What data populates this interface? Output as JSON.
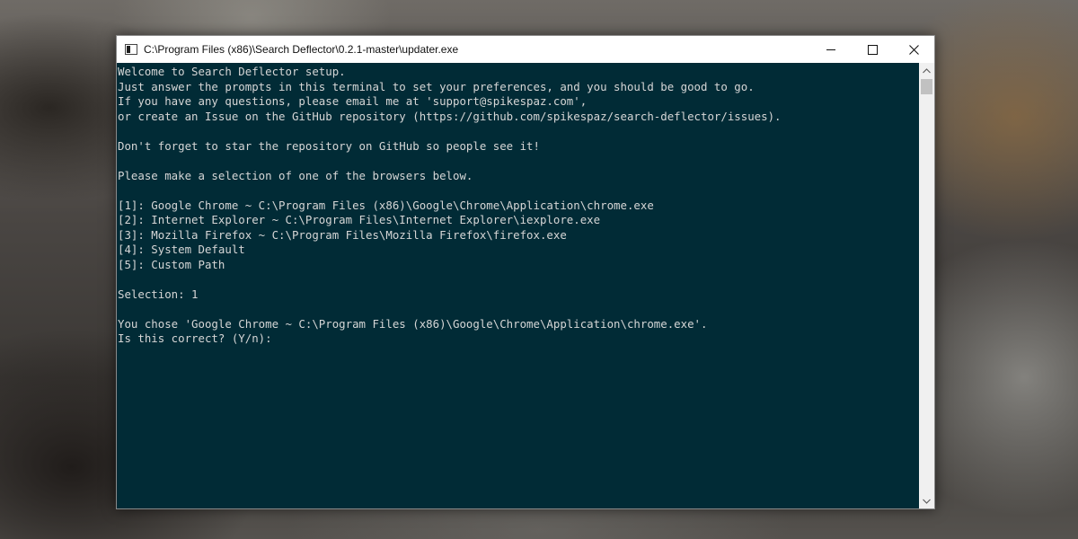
{
  "window": {
    "title": "C:\\Program Files (x86)\\Search Deflector\\0.2.1-master\\updater.exe",
    "icon": "console-icon",
    "controls": [
      "minimize-icon",
      "maximize-icon",
      "close-icon"
    ]
  },
  "terminal": {
    "background": "#012b36",
    "foreground": "#d6d6d6",
    "lines": [
      "Welcome to Search Deflector setup.",
      "Just answer the prompts in this terminal to set your preferences, and you should be good to go.",
      "If you have any questions, please email me at 'support@spikespaz.com',",
      "or create an Issue on the GitHub repository (https://github.com/spikespaz/search-deflector/issues).",
      "",
      "Don't forget to star the repository on GitHub so people see it!",
      "",
      "Please make a selection of one of the browsers below.",
      "",
      "[1]: Google Chrome ~ C:\\Program Files (x86)\\Google\\Chrome\\Application\\chrome.exe",
      "[2]: Internet Explorer ~ C:\\Program Files\\Internet Explorer\\iexplore.exe",
      "[3]: Mozilla Firefox ~ C:\\Program Files\\Mozilla Firefox\\firefox.exe",
      "[4]: System Default",
      "[5]: Custom Path",
      "",
      "Selection: 1",
      "",
      "You chose 'Google Chrome ~ C:\\Program Files (x86)\\Google\\Chrome\\Application\\chrome.exe'.",
      "Is this correct? (Y/n): "
    ]
  },
  "scrollbar": {
    "up_icon": "chevron-up-icon",
    "down_icon": "chevron-down-icon"
  }
}
